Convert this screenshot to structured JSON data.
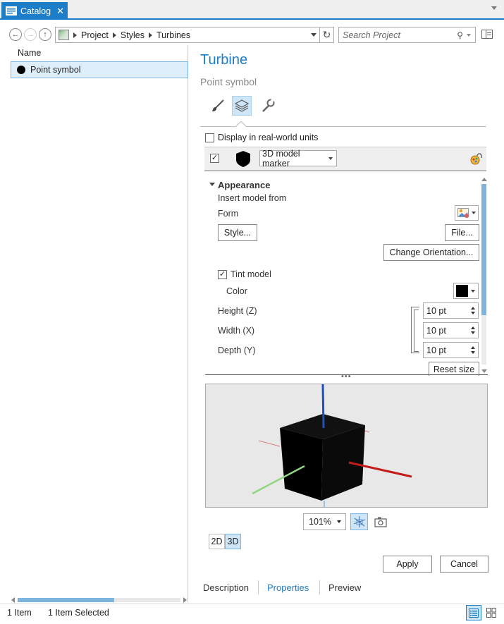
{
  "pane_tab": {
    "title": "Catalog"
  },
  "breadcrumb": [
    "Project",
    "Styles",
    "Turbines"
  ],
  "search": {
    "placeholder": "Search Project"
  },
  "list": {
    "column_header": "Name",
    "items": [
      {
        "label": "Point symbol",
        "selected": true
      }
    ]
  },
  "status": {
    "count": "1 Item",
    "selected": "1 Item Selected"
  },
  "item": {
    "title": "Turbine",
    "subtitle": "Point symbol"
  },
  "symbol": {
    "realworld_label": "Display in real-world units",
    "realworld_checked": false,
    "layer_enabled": true,
    "layer_type": "3D model marker"
  },
  "appearance": {
    "section_title": "Appearance",
    "insert_label": "Insert model from",
    "form_label": "Form",
    "style_button": "Style...",
    "file_button": "File...",
    "orient_button": "Change Orientation...",
    "tint_label": "Tint model",
    "tint_checked": true,
    "color_label": "Color",
    "tint_color": "#000000",
    "height_label": "Height (Z)",
    "height_value": "10 pt",
    "width_label": "Width (X)",
    "width_value": "10 pt",
    "depth_label": "Depth (Y)",
    "depth_value": "10 pt",
    "reset_button": "Reset size"
  },
  "preview": {
    "zoom": "101%",
    "mode_2d": "2D",
    "mode_3d": "3D",
    "active_mode": "3D"
  },
  "actions": {
    "apply": "Apply",
    "cancel": "Cancel"
  },
  "bottom_tabs": {
    "description": "Description",
    "properties": "Properties",
    "preview": "Preview",
    "active": "Properties"
  },
  "colors": {
    "accent": "#1c7dc8",
    "selection": "#deeefa"
  }
}
